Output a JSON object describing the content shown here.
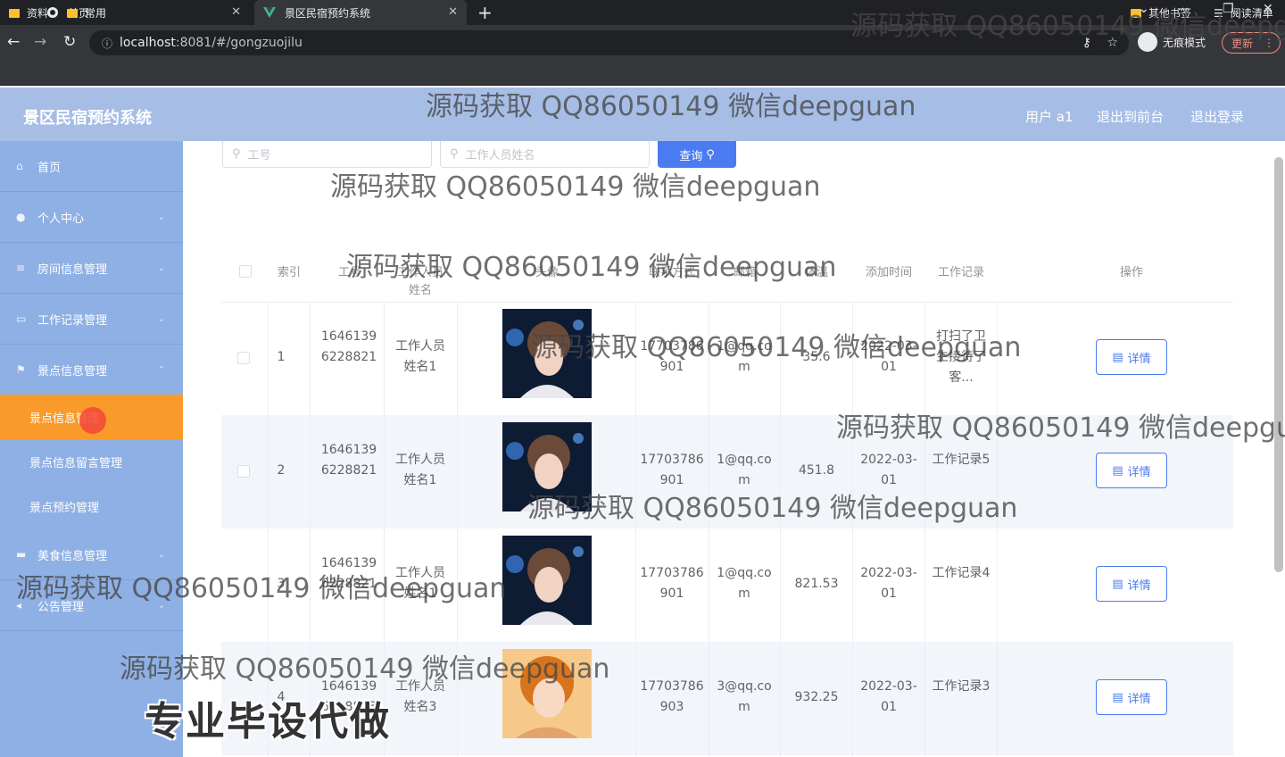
{
  "browser": {
    "tabs": [
      {
        "title": "首页"
      },
      {
        "title": "景区民宿预约系统"
      }
    ],
    "url_host": "localhost",
    "url_rest": ":8081/#/gongzuojilu",
    "incognito_label": "无痕模式",
    "update_label": "更新",
    "bookmarks": [
      "资料",
      "常用"
    ],
    "bookmarks_right": [
      "其他书签",
      "阅读清单"
    ]
  },
  "header": {
    "brand": "景区民宿预约系统",
    "user": "用户 a1",
    "to_front": "退出到前台",
    "logout": "退出登录"
  },
  "sidebar": {
    "menus": [
      {
        "label": "首页",
        "icon": "home-icon"
      },
      {
        "label": "个人中心",
        "icon": "user-icon"
      },
      {
        "label": "房间信息管理",
        "icon": "list-icon"
      },
      {
        "label": "工作记录管理",
        "icon": "briefcase-icon"
      },
      {
        "label": "景点信息管理",
        "icon": "flag-icon"
      }
    ],
    "submenus": [
      "景点信息管理",
      "景点信息留言管理",
      "景点预约管理"
    ],
    "menus_after": [
      {
        "label": "美食信息管理",
        "icon": "food-icon"
      },
      {
        "label": "公告管理",
        "icon": "megaphone-icon"
      }
    ]
  },
  "search": {
    "placeholder_1": "工号",
    "placeholder_2": "工作人员姓名",
    "query_button": "查询"
  },
  "table": {
    "headers": [
      "索引",
      "工号",
      "工作人员姓名",
      "头像",
      "联系方式",
      "邮箱",
      "体温",
      "添加时间",
      "工作记录",
      "操作"
    ],
    "detail_label": "详情",
    "rows": [
      {
        "index": "1",
        "id": "16461396228821",
        "name": "工作人员姓名1",
        "phone": "17703786901",
        "email": "1@qq.com",
        "temp": "35.6",
        "time": "2022-03-01",
        "record": "打扫了卫生接待了客..."
      },
      {
        "index": "2",
        "id": "16461396228821",
        "name": "工作人员姓名1",
        "phone": "17703786901",
        "email": "1@qq.com",
        "temp": "451.8",
        "time": "2022-03-01",
        "record": "工作记录5"
      },
      {
        "index": "3",
        "id": "16461396228821",
        "name": "工作人员姓名1",
        "phone": "17703786901",
        "email": "1@qq.com",
        "temp": "821.53",
        "time": "2022-03-01",
        "record": "工作记录4"
      },
      {
        "index": "4",
        "id": "16461396228823",
        "name": "工作人员姓名3",
        "phone": "17703786903",
        "email": "3@qq.com",
        "temp": "932.25",
        "time": "2022-03-01",
        "record": "工作记录3"
      }
    ]
  },
  "watermark": "源码获取 QQ86050149 微信deepguan",
  "promo": "专业毕设代做",
  "colors": {
    "header": "#a6bde6",
    "sidebar": "#8fb0e4",
    "active": "#f99a2b",
    "primary": "#4a7bf0"
  }
}
